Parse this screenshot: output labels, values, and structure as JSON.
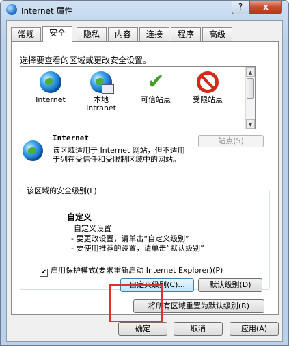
{
  "window": {
    "title": "Internet 属性",
    "help_label": "?",
    "close_label": "x"
  },
  "tabs": [
    {
      "label": "常规"
    },
    {
      "label": "安全"
    },
    {
      "label": "隐私"
    },
    {
      "label": "内容"
    },
    {
      "label": "连接"
    },
    {
      "label": "程序"
    },
    {
      "label": "高级"
    }
  ],
  "active_tab": "安全",
  "security": {
    "zone_prompt": "选择要查看的区域或更改安全设置。",
    "zones": [
      {
        "label": "Internet",
        "label2": "",
        "icon": "globe-icon"
      },
      {
        "label": "本地",
        "label2": "Intranet",
        "icon": "intranet-icon"
      },
      {
        "label": "可信站点",
        "label2": "",
        "icon": "checkmark-icon"
      },
      {
        "label": "受限站点",
        "label2": "",
        "icon": "restricted-icon"
      }
    ],
    "selected_zone": {
      "name": "Internet",
      "description": "该区域适用于 Internet 网站，但不适用于列在受信任和受限制区域中的网站。"
    },
    "sites_button": "站点(S)",
    "level_group": {
      "legend": "该区域的安全级别(L)",
      "title": "自定义",
      "setting": "自定义设置",
      "line1": "- 要更改设置，请单击“自定义级别”",
      "line2": "- 要使用推荐的设置，请单击“默认级别”"
    },
    "protected_mode": {
      "checked": true,
      "label": "启用保护模式(要求重新启动 Internet Explorer)(P)"
    },
    "custom_level_button": "自定义级别(C)...",
    "default_level_button": "默认级别(D)",
    "reset_all_button": "将所有区域重置为默认级别(R)"
  },
  "footer": {
    "ok": "确定",
    "cancel": "取消",
    "apply": "应用(A)"
  },
  "colors": {
    "highlight": "#e03030",
    "accent": "#3c7fb1"
  }
}
